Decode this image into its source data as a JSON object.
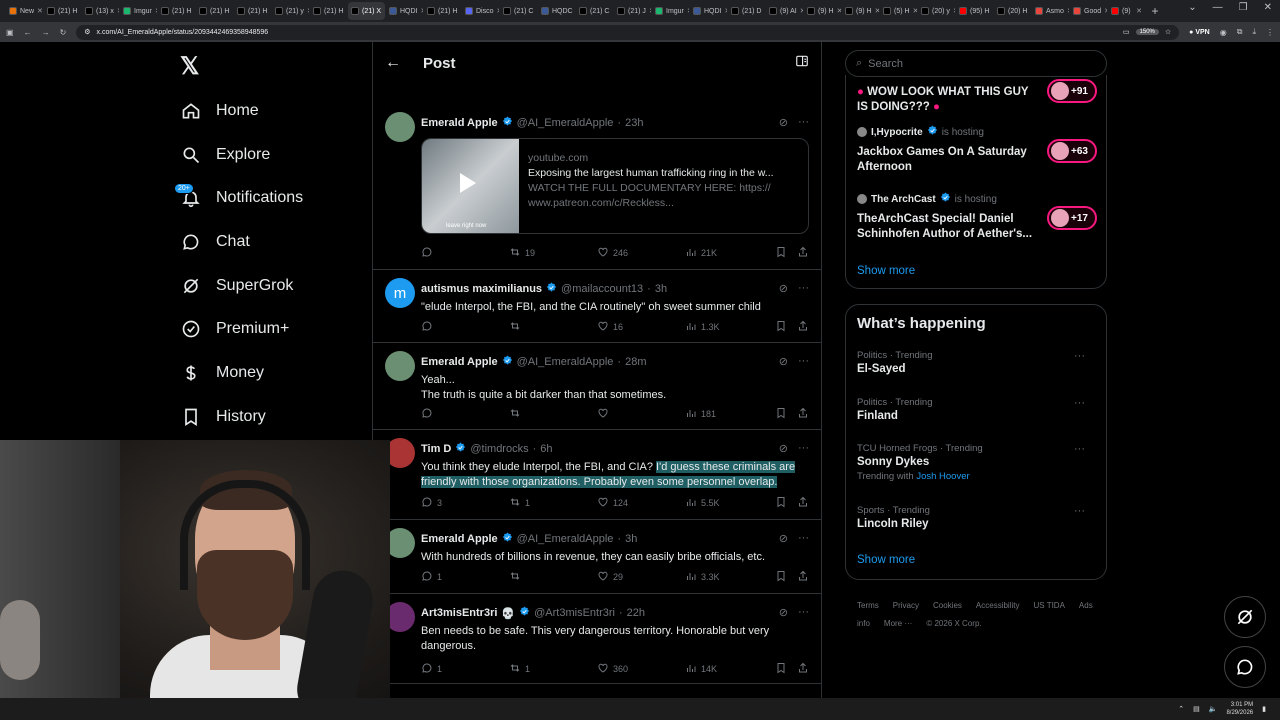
{
  "browser": {
    "tabs": [
      {
        "label": "New",
        "color": "#e8710a"
      },
      {
        "label": "(21) H",
        "color": "#000"
      },
      {
        "label": "(13) x",
        "color": "#000"
      },
      {
        "label": "Imgur",
        "color": "#1bb76e"
      },
      {
        "label": "(21) H",
        "color": "#000"
      },
      {
        "label": "(21) H",
        "color": "#000"
      },
      {
        "label": "(21) H",
        "color": "#000"
      },
      {
        "label": "(21) y",
        "color": "#000"
      },
      {
        "label": "(21) H",
        "color": "#000"
      },
      {
        "label": "(21) X",
        "color": "#000"
      },
      {
        "label": "HQDI",
        "color": "#3b5998"
      },
      {
        "label": "(21) H",
        "color": "#000"
      },
      {
        "label": "Disco",
        "color": "#5865f2"
      },
      {
        "label": "(21) C",
        "color": "#000"
      },
      {
        "label": "HQDC",
        "color": "#3b5998"
      },
      {
        "label": "(21) C",
        "color": "#000"
      },
      {
        "label": "(21) J",
        "color": "#000"
      },
      {
        "label": "Imgur",
        "color": "#1bb76e"
      },
      {
        "label": "HQDI",
        "color": "#3b5998"
      },
      {
        "label": "(21) D",
        "color": "#000"
      },
      {
        "label": "(9) AI",
        "color": "#000"
      },
      {
        "label": "(9) H",
        "color": "#000"
      },
      {
        "label": "(9) H",
        "color": "#000"
      },
      {
        "label": "(5) H",
        "color": "#000"
      },
      {
        "label": "(20) y",
        "color": "#000"
      },
      {
        "label": "(95) H",
        "color": "#ff0000"
      },
      {
        "label": "(20) H",
        "color": "#000"
      },
      {
        "label": "Asmo",
        "color": "#e8453c"
      },
      {
        "label": "Good",
        "color": "#e8453c"
      },
      {
        "label": "(9)",
        "color": "#ff0000"
      }
    ],
    "active_tab_index": 9,
    "url": "x.com/AI_EmeraldApple/status/2093442469358948596",
    "zoom": "150%",
    "vpn": "VPN"
  },
  "nav": {
    "items": [
      {
        "label": "Home",
        "icon": "home-icon"
      },
      {
        "label": "Explore",
        "icon": "search-icon"
      },
      {
        "label": "Notifications",
        "icon": "bell-icon"
      },
      {
        "label": "Chat",
        "icon": "chat-icon"
      },
      {
        "label": "SuperGrok",
        "icon": "grok-icon"
      },
      {
        "label": "Premium+",
        "icon": "premium-icon"
      },
      {
        "label": "Money",
        "icon": "money-icon"
      },
      {
        "label": "History",
        "icon": "bookmark-icon"
      }
    ],
    "notif_badge": "20+"
  },
  "header": {
    "title": "Post"
  },
  "tweets": [
    {
      "name": "Emerald Apple",
      "handle": "@AI_EmeraldApple",
      "time": "23h",
      "text": "",
      "reply": "",
      "rt": "19",
      "like": "246",
      "views": "21K",
      "avatar": "#6b8f72"
    },
    {
      "name": "autismus maximilianus",
      "handle": "@mailaccount13",
      "time": "3h",
      "text": "\"elude Interpol, the FBI, and the CIA routinely\" oh sweet summer child",
      "reply": "",
      "rt": "",
      "like": "16",
      "views": "1.3K",
      "avatar": "#1d9bf0",
      "initial": "m"
    },
    {
      "name": "Emerald Apple",
      "handle": "@AI_EmeraldApple",
      "time": "28m",
      "text": "Yeah...\nThe truth is quite a bit darker than that sometimes.",
      "reply": "",
      "rt": "",
      "like": "",
      "views": "181",
      "avatar": "#6b8f72"
    },
    {
      "name": "Tim D",
      "handle": "@timdrocks",
      "time": "6h",
      "text_plain": "You think they elude Interpol, the FBI, and CIA? ",
      "text_hl": "I'd guess these criminals are friendly with those organizations. Probably even some personnel overlap.",
      "reply": "3",
      "rt": "1",
      "like": "124",
      "views": "5.5K",
      "avatar": "#a33"
    },
    {
      "name": "Emerald Apple",
      "handle": "@AI_EmeraldApple",
      "time": "3h",
      "text": "With hundreds of billions in revenue, they can easily bribe officials, etc.",
      "reply": "1",
      "rt": "",
      "like": "29",
      "views": "3.3K",
      "avatar": "#6b8f72"
    },
    {
      "name": "Art3misEntr3ri",
      "skull": "💀",
      "handle": "@Art3misEntr3ri",
      "time": "22h",
      "text": "Ben needs to be safe. This very dangerous territory. Honorable but very dangerous.",
      "reply": "1",
      "rt": "1",
      "like": "360",
      "views": "14K",
      "avatar": "#6a2a6e"
    }
  ],
  "link_card": {
    "domain": "youtube.com",
    "title": "Exposing the largest human trafficking ring in the w...",
    "desc": "WATCH THE FULL DOCUMENTARY HERE: https://\nwww.patreon.com/c/Reckless...",
    "watermark": "leave right now"
  },
  "right": {
    "search_placeholder": "Search",
    "spaces": [
      {
        "host": "",
        "status": "",
        "title": "WOW LOOK WHAT THIS GUY IS DOING???",
        "count": "+91",
        "pill_color": "#f91880"
      },
      {
        "host": "I,Hypocrite",
        "status": "is hosting",
        "title": "Jackbox Games On A Saturday Afternoon",
        "count": "+63",
        "pill_color": "#f91880"
      },
      {
        "host": "The ArchCast",
        "status": "is hosting",
        "title": "TheArchCast Special! Daniel Schinhofen Author of Aether's...",
        "count": "+17",
        "pill_color": "#f91880"
      }
    ],
    "show_more": "Show more",
    "happening_title": "What’s happening",
    "trends": [
      {
        "cat": "Politics · Trending",
        "name": "El-Sayed",
        "with": ""
      },
      {
        "cat": "Politics · Trending",
        "name": "Finland",
        "with": ""
      },
      {
        "cat": "TCU Horned Frogs · Trending",
        "name": "Sonny Dykes",
        "with": "Trending with",
        "with_link": "Josh Hoover"
      },
      {
        "cat": "Sports · Trending",
        "name": "Lincoln Riley",
        "with": ""
      }
    ],
    "show_more_2": "Show more",
    "footer": [
      "Terms",
      "Privacy",
      "Cookies",
      "Accessibility",
      "US TIDA",
      "Ads info",
      "More ···",
      "© 2026 X Corp."
    ]
  },
  "taskbar": {
    "time": "3:01 PM",
    "date": "8/29/2026"
  },
  "colors": {
    "accent": "#1d9bf0",
    "border": "#2f3336",
    "muted": "#71767b",
    "spaces_pill": "#f91880"
  }
}
